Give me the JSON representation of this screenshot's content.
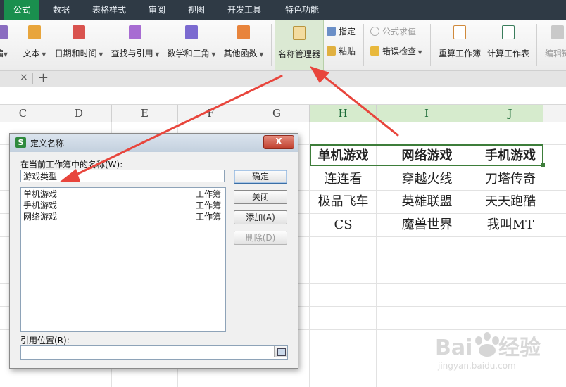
{
  "menu": {
    "tabs": [
      {
        "label": "公式",
        "active": true
      },
      {
        "label": "数据",
        "active": false
      },
      {
        "label": "表格样式",
        "active": false
      },
      {
        "label": "审阅",
        "active": false
      },
      {
        "label": "视图",
        "active": false
      },
      {
        "label": "开发工具",
        "active": false
      },
      {
        "label": "特色功能",
        "active": false
      }
    ]
  },
  "ribbon": {
    "edit_partial": "编",
    "text": "文本",
    "datetime": "日期和时间",
    "lookup": "查找与引用",
    "math": "数学和三角",
    "other": "其他函数",
    "name_manager": "名称管理器",
    "specify": "指定",
    "paste": "粘贴",
    "formula_eval": "公式求值",
    "error_check": "错误检查",
    "recalc_book": "重算工作簿",
    "calc_sheet": "计算工作表",
    "edit_link_partial": "编辑链"
  },
  "sheet": {
    "columns": [
      "C",
      "D",
      "E",
      "F",
      "G",
      "H",
      "I",
      "J"
    ],
    "header_row": [
      "单机游戏",
      "网络游戏",
      "手机游戏"
    ],
    "rows": [
      [
        "连连看",
        "穿越火线",
        "刀塔传奇"
      ],
      [
        "极品飞车",
        "英雄联盟",
        "天天跑酷"
      ],
      [
        "CS",
        "魔兽世界",
        "我叫MT"
      ]
    ]
  },
  "dialog": {
    "title": "定义名称",
    "close": "X",
    "names_label": "在当前工作簿中的名称(W):",
    "name_value": "游戏类型",
    "list": [
      {
        "name": "单机游戏",
        "scope": "工作簿"
      },
      {
        "name": "手机游戏",
        "scope": "工作簿"
      },
      {
        "name": "网络游戏",
        "scope": "工作簿"
      }
    ],
    "buttons": {
      "ok": "确定",
      "close": "关闭",
      "add": "添加(A)",
      "delete": "删除(D)"
    },
    "ref_label": "引用位置(R):",
    "ref_value": ""
  },
  "colors": {
    "menubar": "#2f3a45",
    "active_tab": "#1a8f4e",
    "selection": "#3d7d3a",
    "arrow": "#e8453c"
  }
}
